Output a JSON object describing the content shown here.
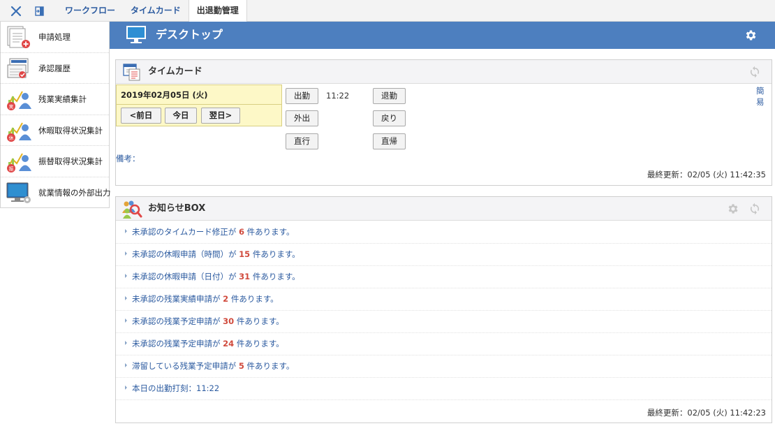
{
  "topbar": {
    "tabs": [
      {
        "label": "ワークフロー",
        "active": false
      },
      {
        "label": "タイムカード",
        "active": false
      },
      {
        "label": "出退勤管理",
        "active": true
      }
    ]
  },
  "sidebar": {
    "items": [
      {
        "label": "申請処理",
        "icon": "document-add-icon"
      },
      {
        "label": "承認履歴",
        "icon": "approval-history-icon"
      },
      {
        "label": "残業実績集計",
        "icon": "overtime-chart-icon"
      },
      {
        "label": "休暇取得状況集計",
        "icon": "leave-chart-icon"
      },
      {
        "label": "振替取得状況集計",
        "icon": "substitute-chart-icon"
      },
      {
        "label": "就業情報の外部出力",
        "icon": "monitor-export-icon"
      }
    ]
  },
  "desktop": {
    "title": "デスクトップ"
  },
  "timecard": {
    "title": "タイムカード",
    "date": "2019年02月05日 (火)",
    "prev_label": "<前日",
    "today_label": "今日",
    "next_label": "翌日>",
    "clock_in_label": "出勤",
    "clock_in_time": "11:22",
    "clock_out_label": "退勤",
    "out_label": "外出",
    "return_label": "戻り",
    "direct_go_label": "直行",
    "direct_return_label": "直帰",
    "simple_label": "簡易",
    "note_label": "備考：",
    "last_updated": "最終更新：02/05 (火) 11:42:35"
  },
  "notices": {
    "title": "お知らせBOX",
    "items": [
      {
        "prefix": "未承認のタイムカード修正が",
        "count": "6",
        "suffix": "件あります。"
      },
      {
        "prefix": "未承認の休暇申請（時間）が",
        "count": "15",
        "suffix": "件あります。"
      },
      {
        "prefix": "未承認の休暇申請（日付）が",
        "count": "31",
        "suffix": "件あります。"
      },
      {
        "prefix": "未承認の残業実績申請が",
        "count": "2",
        "suffix": "件あります。"
      },
      {
        "prefix": "未承認の残業予定申請が",
        "count": "30",
        "suffix": "件あります。"
      },
      {
        "prefix": "未承認の残業予定申請が",
        "count": "24",
        "suffix": "件あります。"
      },
      {
        "prefix": "滞留している残業予定申請が",
        "count": "5",
        "suffix": "件あります。"
      },
      {
        "prefix": "本日の出勤打刻：11:22",
        "count": "",
        "suffix": ""
      }
    ],
    "last_updated": "最終更新：02/05 (火) 11:42:23"
  },
  "colors": {
    "header_blue": "#4d7fbf",
    "link_blue": "#2c5ba0",
    "count_red": "#d04a3c",
    "timecard_yellow": "#fdf8c7"
  }
}
